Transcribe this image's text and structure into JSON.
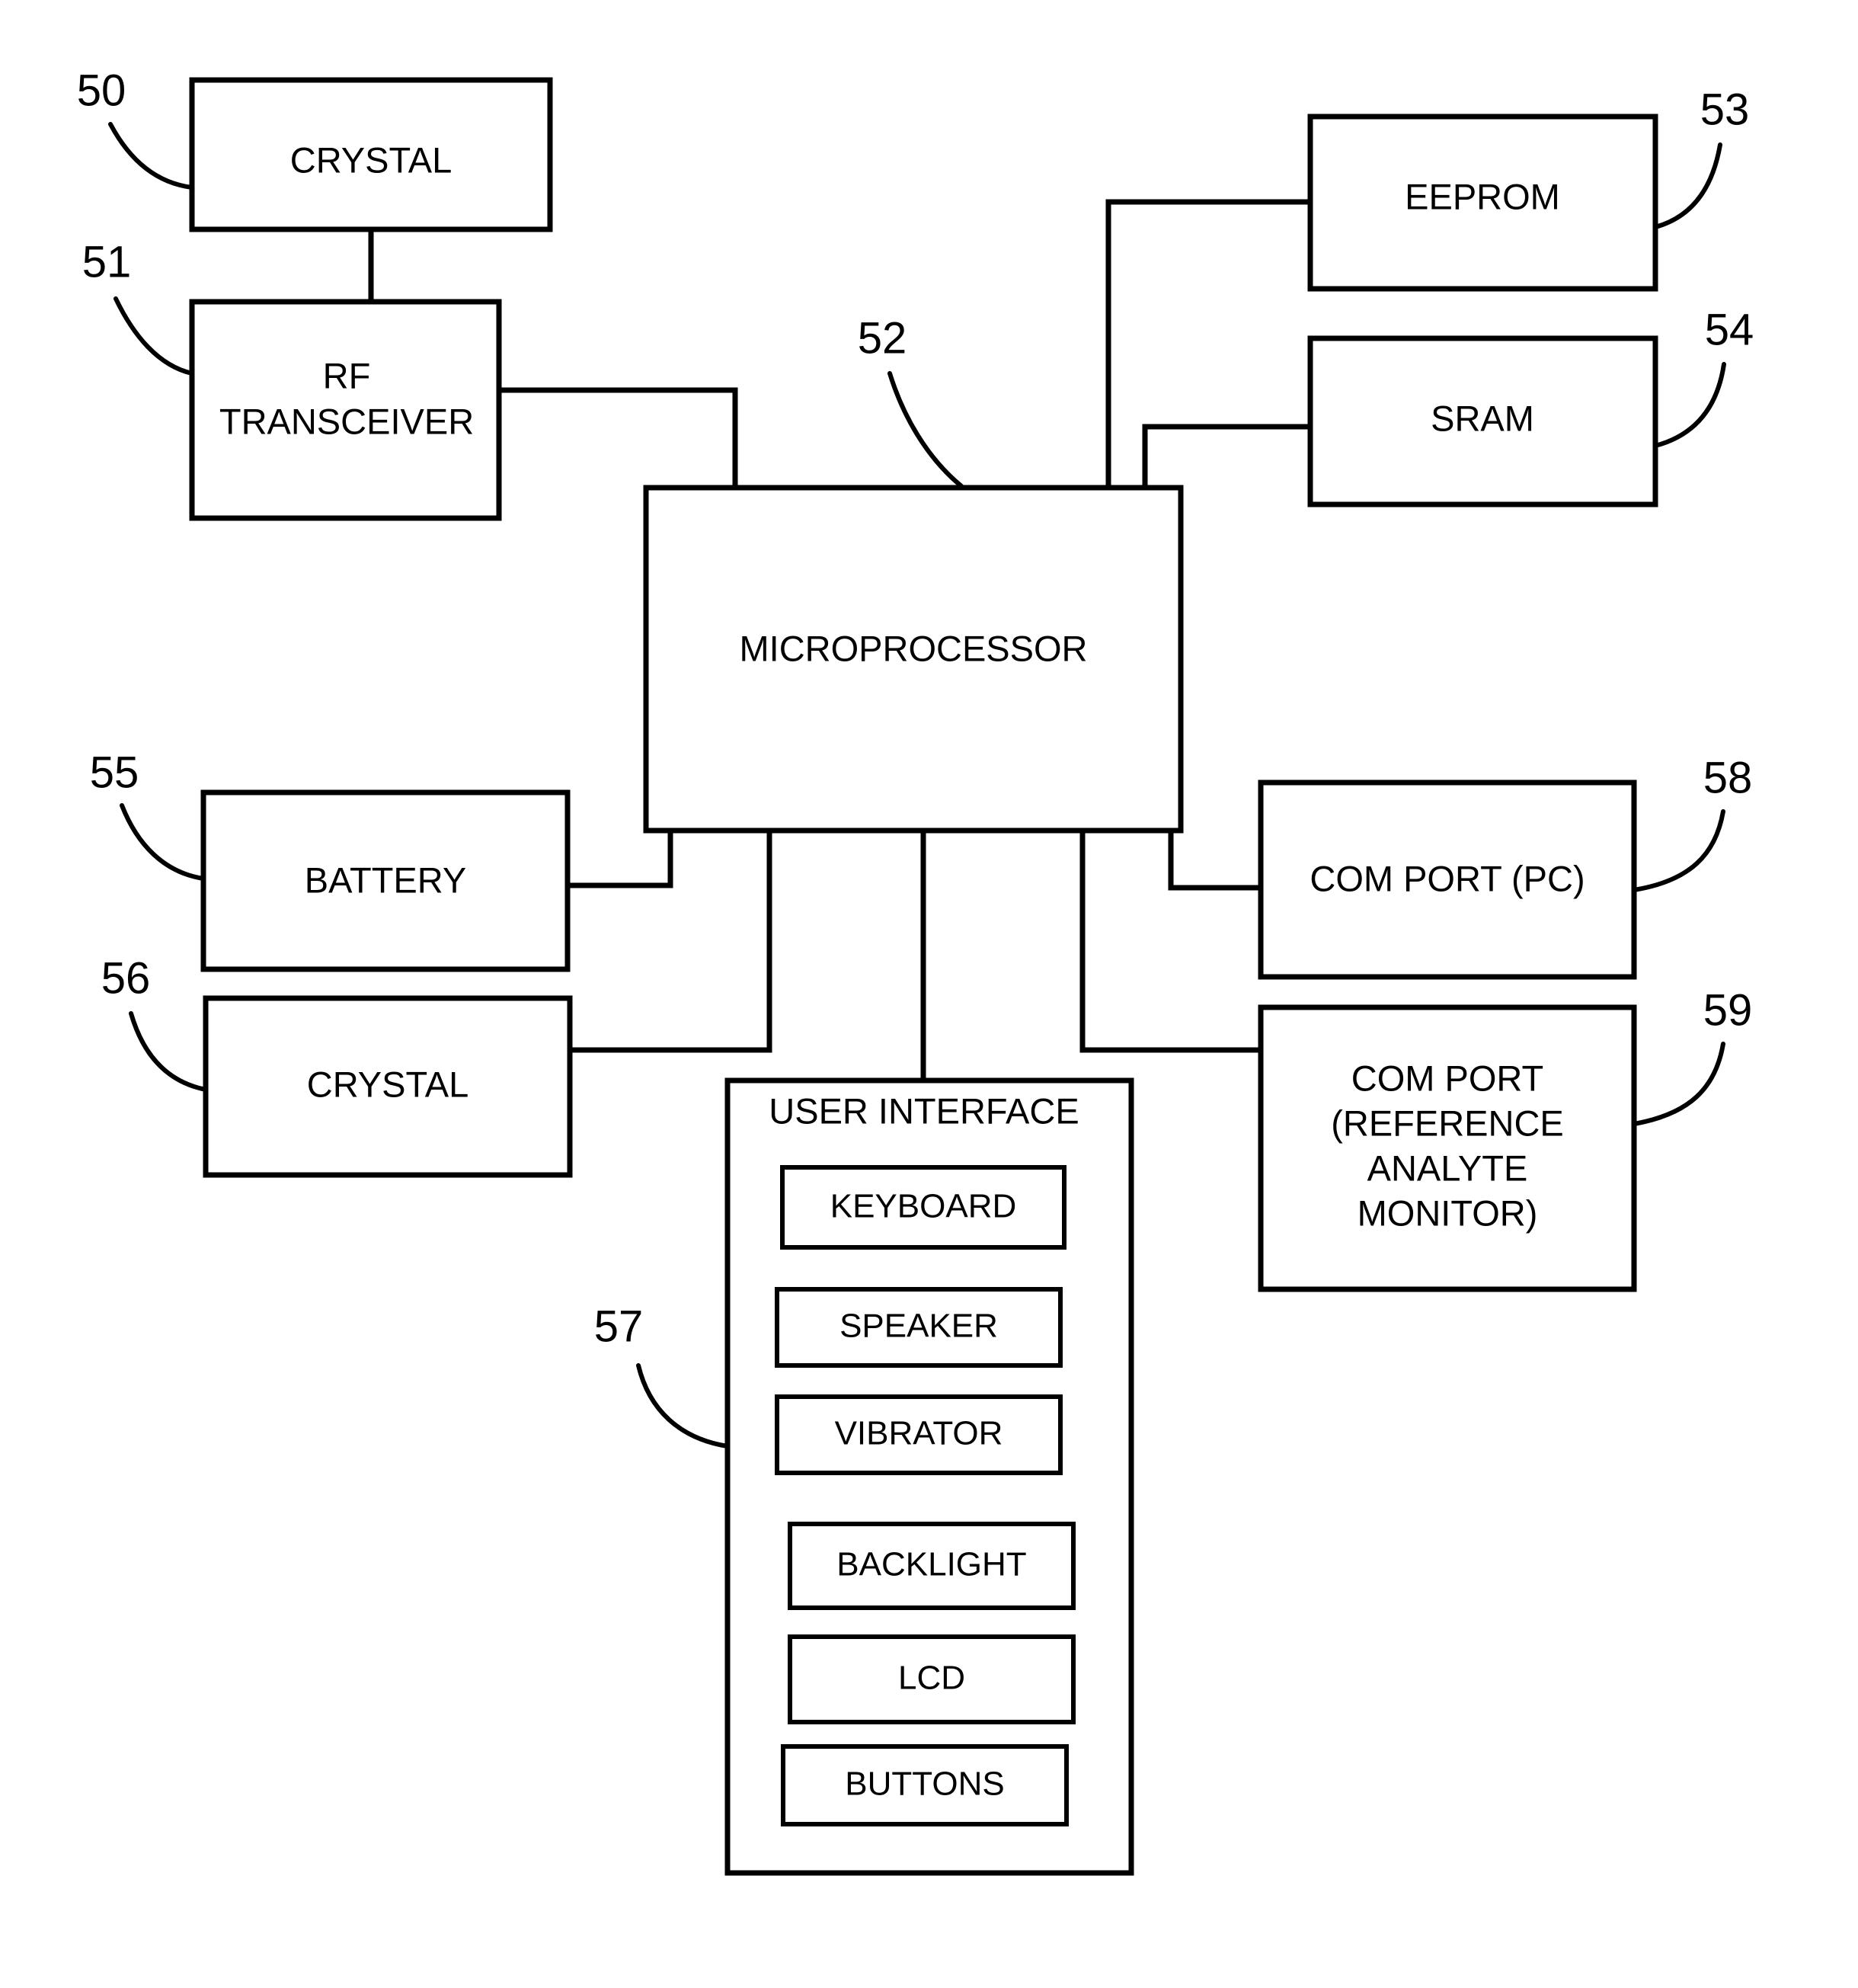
{
  "figure": {
    "type": "patent-block-diagram",
    "background_color": "#ffffff",
    "line_color": "#000000"
  },
  "blocks": {
    "crystal_top": {
      "label": "CRYSTAL",
      "ref": "50"
    },
    "rf_transceiver": {
      "label_line1": "RF",
      "label_line2": "TRANSCEIVER",
      "ref": "51"
    },
    "microprocessor": {
      "label": "MICROPROCESSOR",
      "ref": "52"
    },
    "eeprom": {
      "label": "EEPROM",
      "ref": "53"
    },
    "sram": {
      "label": "SRAM",
      "ref": "54"
    },
    "battery": {
      "label": "BATTERY",
      "ref": "55"
    },
    "crystal_bottom": {
      "label": "CRYSTAL",
      "ref": "56"
    },
    "user_interface": {
      "label": "USER INTERFACE",
      "ref": "57"
    },
    "com_port_pc": {
      "label": "COM PORT (PC)",
      "ref": "58"
    },
    "com_port_reference": {
      "label_line1": "COM PORT",
      "label_line2": "(REFERENCE",
      "label_line3": "ANALYTE",
      "label_line4": "MONITOR)",
      "ref": "59"
    }
  },
  "user_interface_items": [
    {
      "label": "KEYBOARD"
    },
    {
      "label": "SPEAKER"
    },
    {
      "label": "VIBRATOR"
    },
    {
      "label": "BACKLIGHT"
    },
    {
      "label": "LCD"
    },
    {
      "label": "BUTTONS"
    }
  ]
}
